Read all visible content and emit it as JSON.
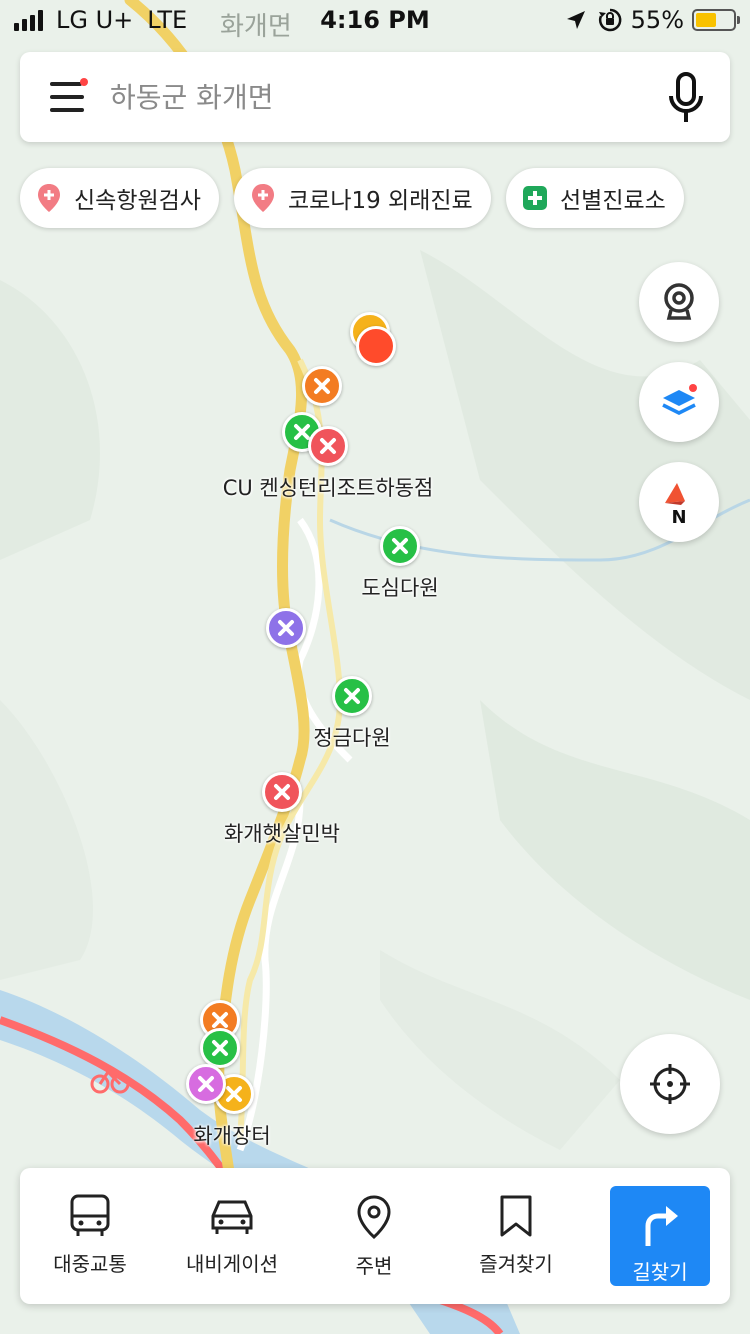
{
  "status_bar": {
    "carrier": "LG U+",
    "network": "LTE",
    "place_hint": "화개면",
    "time": "4:16 PM",
    "battery_percent": "55%",
    "battery_level": 0.55,
    "icons": [
      "signal-icon",
      "location-arrow-icon",
      "rotation-lock-icon",
      "battery-icon"
    ]
  },
  "search": {
    "placeholder": "하동군 화개면",
    "icons": [
      "menu-icon",
      "microphone-icon"
    ]
  },
  "chips": [
    {
      "label": "신속항원검사",
      "icon": "pin-icon"
    },
    {
      "label": "코로나19 외래진료",
      "icon": "pin-icon"
    },
    {
      "label": "선별진료소",
      "icon": "medical-cross-icon"
    }
  ],
  "map_controls": [
    "cctv-icon",
    "layers-icon",
    "compass-icon",
    "current-location-icon"
  ],
  "compass_letter": "N",
  "map_labels": {
    "cu": "CU 켄싱턴리조트하동점",
    "dosim": "도심다원",
    "jeonggeum": "정금다원",
    "hwagae_hat": "화개햇살민박",
    "jangter": "화개장터"
  },
  "colors": {
    "accent": "#1e88f5",
    "marker_orange": "#f37c22",
    "marker_green": "#27c046",
    "marker_red": "#f0545b",
    "marker_purple": "#8e72e8",
    "marker_pink": "#d76ce0",
    "marker_yellow": "#f5b21b",
    "road_yellow": "#f1d165",
    "river": "#b8d8ec"
  },
  "bottom_nav": [
    {
      "label": "대중교통",
      "icon": "bus-icon"
    },
    {
      "label": "내비게이션",
      "icon": "car-icon"
    },
    {
      "label": "주변",
      "icon": "pin-outline-icon"
    },
    {
      "label": "즐겨찾기",
      "icon": "bookmark-icon"
    },
    {
      "label": "길찾기",
      "icon": "turn-right-arrow-icon"
    }
  ]
}
